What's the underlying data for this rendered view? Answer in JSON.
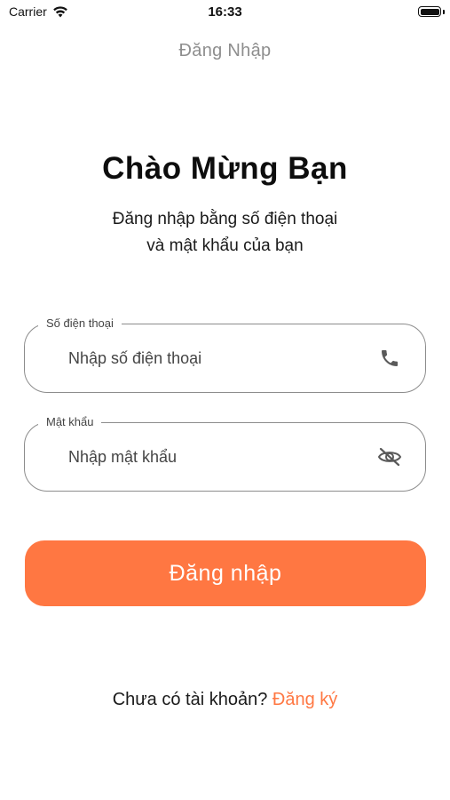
{
  "status_bar": {
    "carrier": "Carrier",
    "time": "16:33"
  },
  "nav": {
    "title": "Đăng Nhập"
  },
  "header": {
    "title": "Chào Mừng Bạn",
    "subtitle_line1": "Đăng nhập bằng số điện thoại",
    "subtitle_line2": "và mật khẩu của bạn"
  },
  "form": {
    "phone": {
      "label": "Số điện thoại",
      "placeholder": "Nhập số điện thoại",
      "value": "",
      "icon": "phone-icon"
    },
    "password": {
      "label": "Mật khẩu",
      "placeholder": "Nhập mật khẩu",
      "value": "",
      "icon": "eye-off-icon"
    },
    "submit_label": "Đăng nhập"
  },
  "footer": {
    "prompt": "Chưa có tài khoản?",
    "register_label": "Đăng ký"
  },
  "colors": {
    "accent": "#ff7742",
    "field_border": "#8c8c8c",
    "nav_title": "#8e8e8e",
    "background": "#ffffff"
  }
}
